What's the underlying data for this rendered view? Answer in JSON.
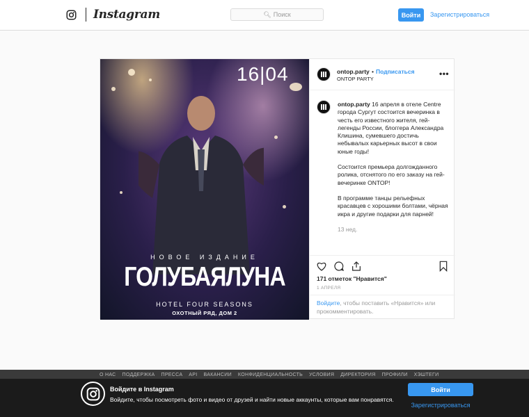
{
  "header": {
    "wordmark": "Instagram",
    "search_placeholder": "Поиск",
    "login_label": "Войти",
    "signup_label": "Зарегистрироваться"
  },
  "post": {
    "username": "ontop.party",
    "separator": "•",
    "follow_label": "Подписаться",
    "location": "ONTOP PARTY",
    "more_label": "•••",
    "image_text": {
      "date": "16|04",
      "subtitle": "НОВОЕ ИЗДАНИЕ",
      "title": "ГОЛУБАЯЛУНА",
      "venue": "HOTEL FOUR SEASONS",
      "address": "ОХОТНЫЙ РЯД, ДОМ 2"
    },
    "caption_p1": "16 апреля в отеле Centre города Сургут состоится вечеринка в честь его известного жителя, гей-легенды России, блоггера Александра Клишина, сумевшего достичь небывалых карьерных высот в свои юные годы!",
    "caption_p2": "Состоится премьера долгожданного ролика, отснятого по его заказу на гей-вечеринке ONTOP!",
    "caption_p3": "В программе танцы рельефных красавцев с хорошими болтами, чёрная икра и другие подарки для парней!",
    "time_ago": "13 нед.",
    "likes": "171 отметок \"Нравится\"",
    "date": "1 АПРЕЛЯ",
    "prompt_link": "Войдите",
    "prompt_text": ", чтобы поставить «Нравится» или прокомментировать."
  },
  "footer": {
    "links": [
      "О НАС",
      "ПОДДЕРЖКА",
      "ПРЕССА",
      "API",
      "ВАКАНСИИ",
      "КОНФИДЕНЦИАЛЬНОСТЬ",
      "УСЛОВИЯ",
      "ДИРЕКТОРИЯ",
      "ПРОФИЛИ",
      "ХЭШТЕГИ"
    ]
  },
  "banner": {
    "title": "Войдите в Instagram",
    "text": "Войдите, чтобы посмотреть фото и видео от друзей и найти новые аккаунты, которые вам понравятся.",
    "login_label": "Войти",
    "signup_label": "Зарегистрироваться"
  },
  "colors": {
    "accent": "#3897f0",
    "banner_bg": "#1b1b1b"
  }
}
